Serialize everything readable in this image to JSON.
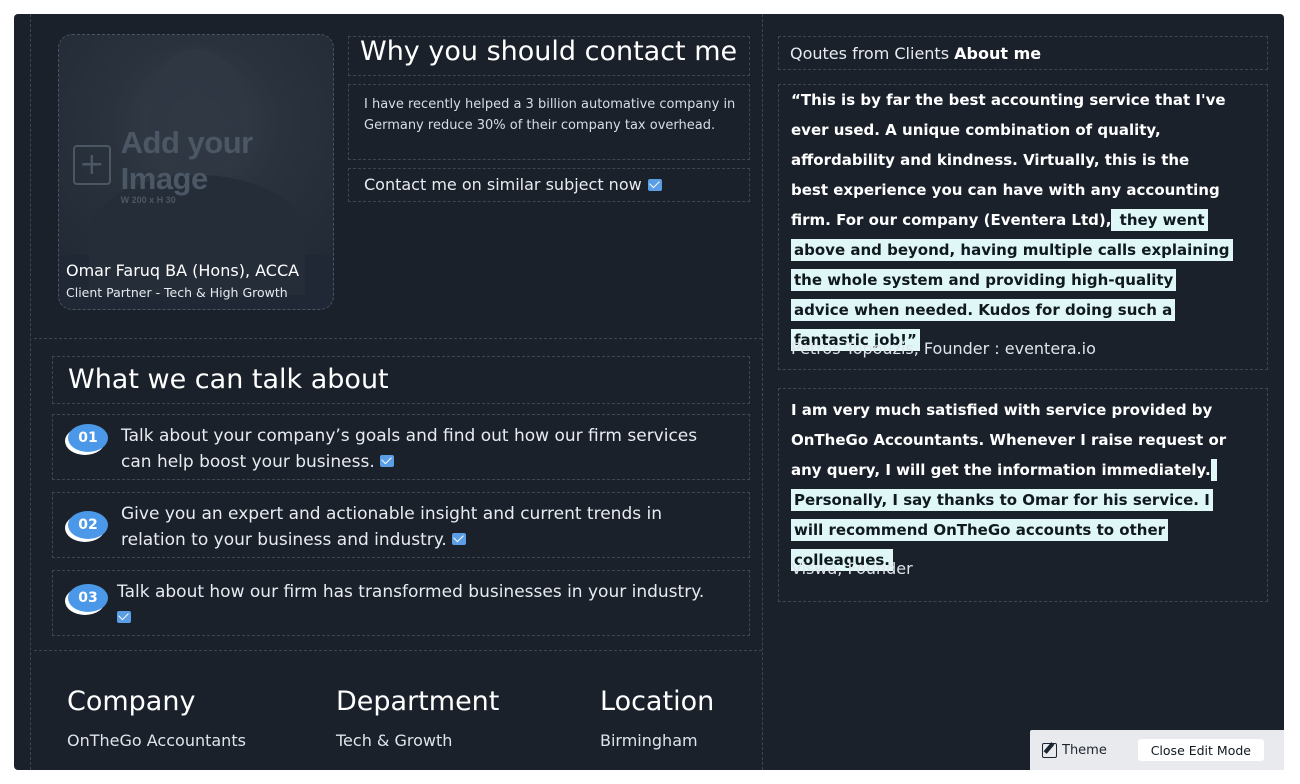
{
  "profile": {
    "image_placeholder_title": "Add your Image",
    "image_placeholder_size": "W 200 x H 30",
    "name": "Omar Faruq BA (Hons), ACCA",
    "role": "Client Partner - Tech & High Growth"
  },
  "why": {
    "title": "Why you should contact me",
    "text": "I have recently helped a 3 billion automative company in Germany reduce 30% of their company tax overhead.",
    "contact_link": "Contact me on similar subject now"
  },
  "talk": {
    "title": "What we can talk about",
    "items": [
      {
        "number": "01",
        "text": "Talk about your company’s goals and find out how our firm services can help boost your business."
      },
      {
        "number": "02",
        "text": "Give you an expert and actionable insight and current trends in relation to your business and industry."
      },
      {
        "number": "03",
        "text": "Talk about how our firm has transformed businesses in your industry."
      }
    ]
  },
  "info": {
    "company_label": "Company",
    "company_value": "OnTheGo Accountants",
    "department_label": "Department",
    "department_value": "Tech & Growth",
    "location_label": "Location",
    "location_value": "Birmingham"
  },
  "quotes": {
    "heading_plain": "Qoutes from Clients",
    "heading_bold": "About me",
    "items": [
      {
        "text_plain": "“This is by far the best accounting service that I've ever used. A unique combination of quality, affordability and kindness. Virtually, this is the best experience you can have with any accounting firm. For our company (Eventera Ltd),",
        "text_highlight": " they went above and beyond, having multiple calls explaining the whole system and providing high-quality advice when needed. Kudos for doing such a fantastic job!”",
        "author": "Petros Topouzis, Founder : eventera.io"
      },
      {
        "text_plain": "I am very much satisfied with service provided by OnTheGo Accountants. Whenever I raise request or any query, I will get the information immediately.",
        "text_highlight": " Personally, I say thanks to Omar for his service. I will recommend OnTheGo accounts to other colleagues.",
        "author": "Viswa, Founder"
      }
    ]
  },
  "toolbar": {
    "theme_label": "Theme",
    "close_label": "Close Edit Mode"
  },
  "colors": {
    "background": "#1a212b",
    "highlight": "#dff7f6",
    "badge": "#4b98e8"
  }
}
